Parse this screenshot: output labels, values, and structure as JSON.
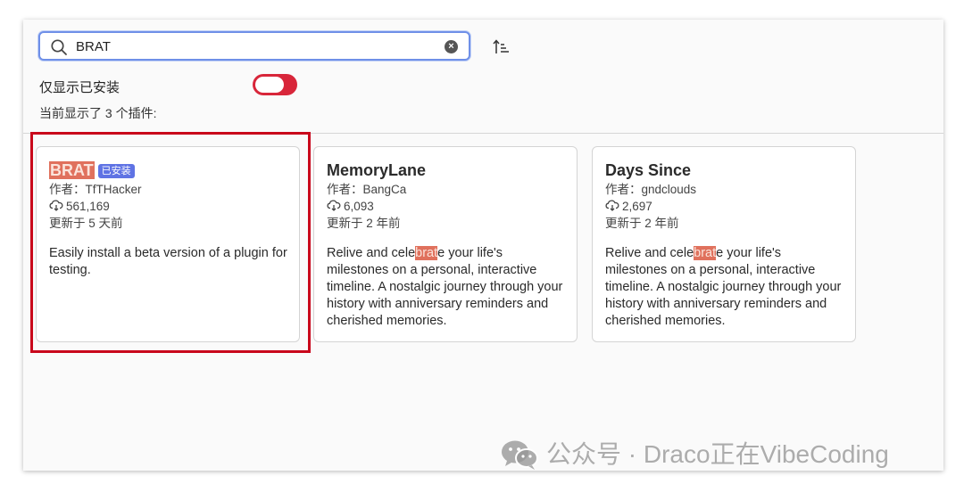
{
  "search": {
    "value": "BRAT",
    "icon": "search-icon",
    "clear_icon": "clear-icon"
  },
  "toolbar": {
    "sort_icon": "sort-ascending-icon"
  },
  "filter": {
    "installed_only_label": "仅显示已安装",
    "installed_only_on": true
  },
  "summary": {
    "count_label": "当前显示了 3 个插件:"
  },
  "plugins": [
    {
      "name": "BRAT",
      "badge": "已安装",
      "author": "作者：TfTHacker",
      "downloads": "561,169",
      "updated": "更新于 5 天前",
      "description": "Easily install a beta version of a plugin for testing.",
      "selected": true
    },
    {
      "name": "MemoryLane",
      "author": "作者：BangCa",
      "downloads": "6,093",
      "updated": "更新于 2 年前",
      "desc_before": "Relive and cele",
      "desc_match": "brat",
      "desc_after": "e your life's milestones on a personal, interactive timeline. A nostalgic journey through your history with anniversary reminders and cherished memories."
    },
    {
      "name": "Days Since",
      "author": "作者：gndclouds",
      "downloads": "2,697",
      "updated": "更新于 2 年前",
      "desc_before": "Relive and cele",
      "desc_match": "brat",
      "desc_after": "e your life's milestones on a personal, interactive timeline. A nostalgic journey through your history with anniversary reminders and cherished memories."
    }
  ],
  "watermark": {
    "text": "公众号 · Draco正在VibeCoding",
    "icon": "wechat-icon"
  },
  "colors": {
    "accent": "#6f90e8",
    "toggle_on": "#d8263a",
    "highlight": "#e0715d",
    "badge": "#5f73e4",
    "selection_box": "#c9061b"
  }
}
